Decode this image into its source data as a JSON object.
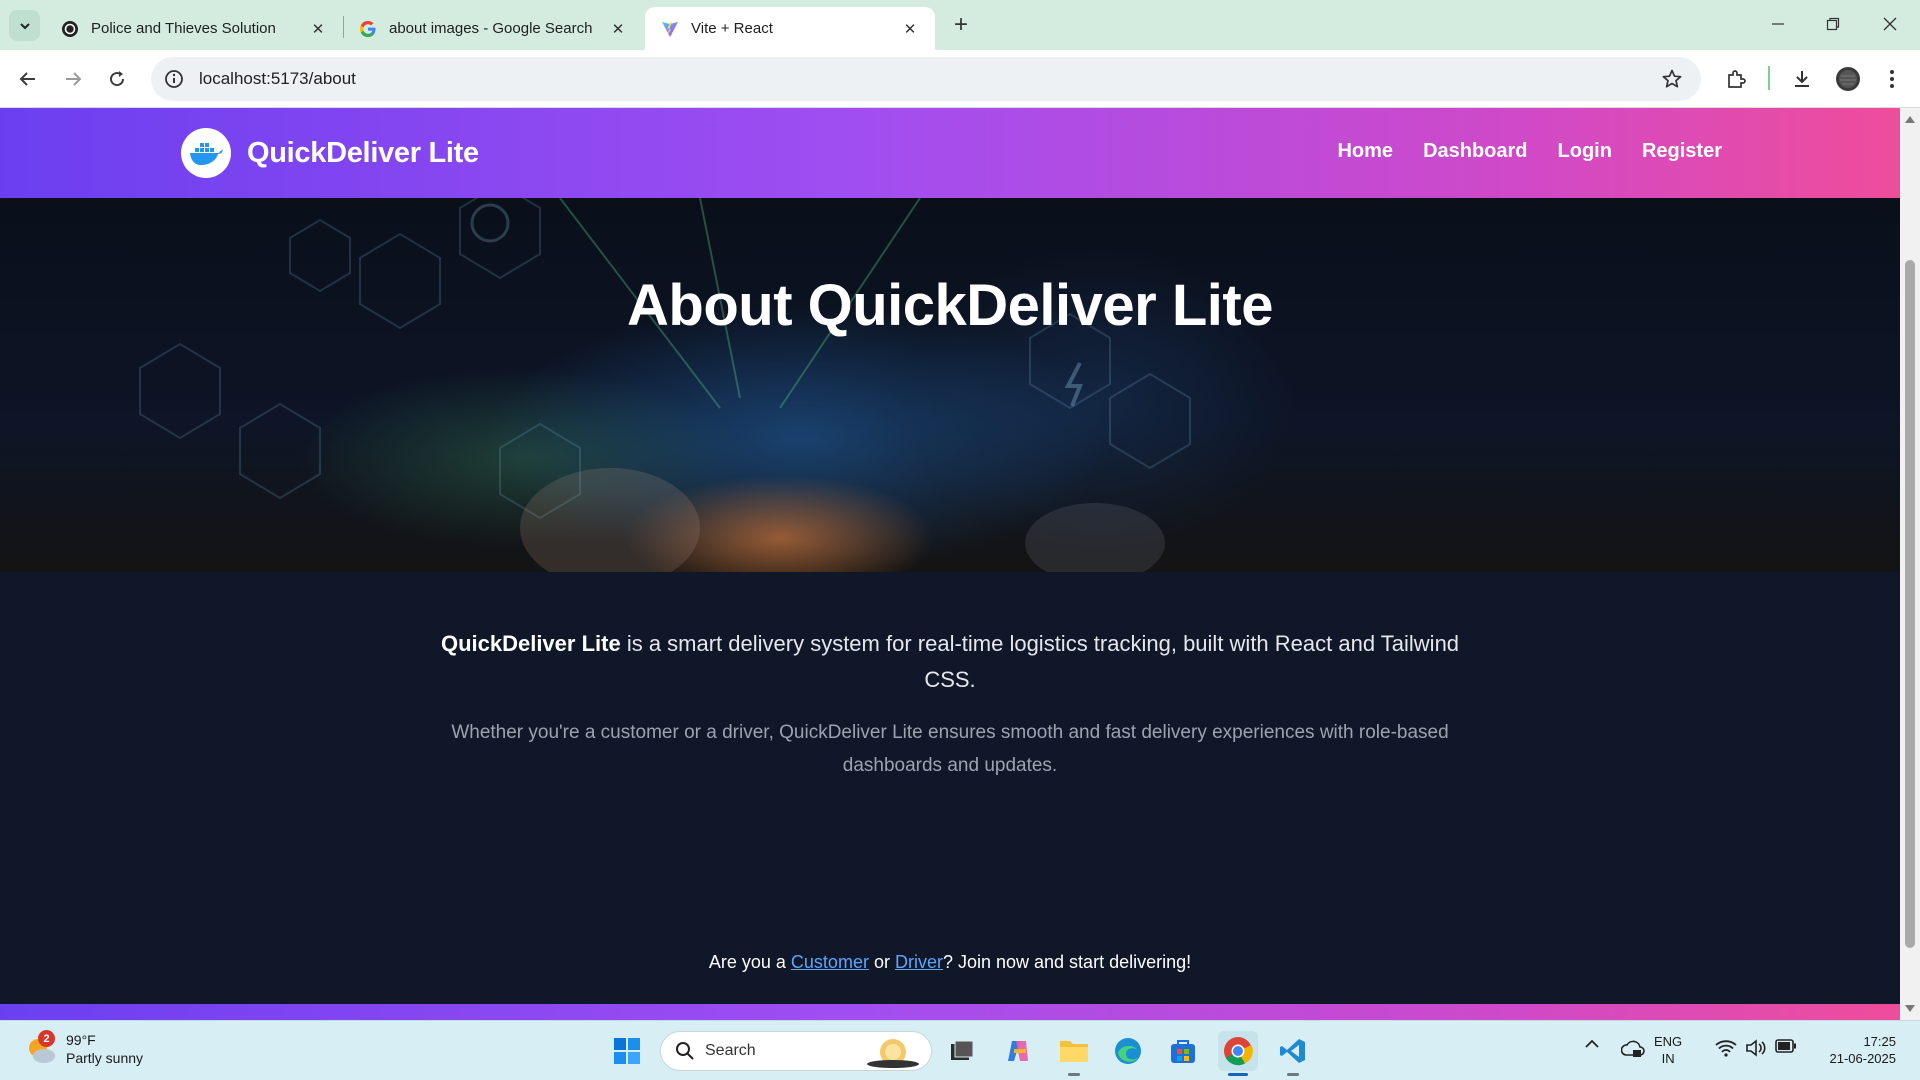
{
  "browser": {
    "tabs": [
      {
        "title": "Police and Thieves Solution",
        "icon": "chatgpt-icon",
        "active": false
      },
      {
        "title": "about images - Google Search",
        "icon": "google-icon",
        "active": false
      },
      {
        "title": "Vite + React",
        "icon": "vite-icon",
        "active": true
      }
    ],
    "url": "localhost:5173/about"
  },
  "site": {
    "brand": "QuickDeliver Lite",
    "nav": [
      "Home",
      "Dashboard",
      "Login",
      "Register"
    ],
    "hero_title": "About QuickDeliver Lite",
    "lead_strong": "QuickDeliver Lite",
    "lead_rest": " is a smart delivery system for real-time logistics tracking, built with React and Tailwind CSS.",
    "sub": "Whether you're a customer or a driver, QuickDeliver Lite ensures smooth and fast delivery experiences with role-based dashboards and updates.",
    "cta": {
      "prefix": "Are you a ",
      "customer": "Customer",
      "middle": " or ",
      "driver": "Driver",
      "suffix": "? Join now and start delivering!"
    },
    "colors": {
      "gradient_start": "#6b3ff0",
      "gradient_end": "#ef4d9a",
      "background": "#101729",
      "link": "#60a5fa"
    }
  },
  "taskbar": {
    "weather": {
      "temp": "99°F",
      "condition": "Partly sunny",
      "badge": "2"
    },
    "search_placeholder": "Search",
    "lang": {
      "line1": "ENG",
      "line2": "IN"
    },
    "time": "17:25",
    "date": "21-06-2025"
  }
}
